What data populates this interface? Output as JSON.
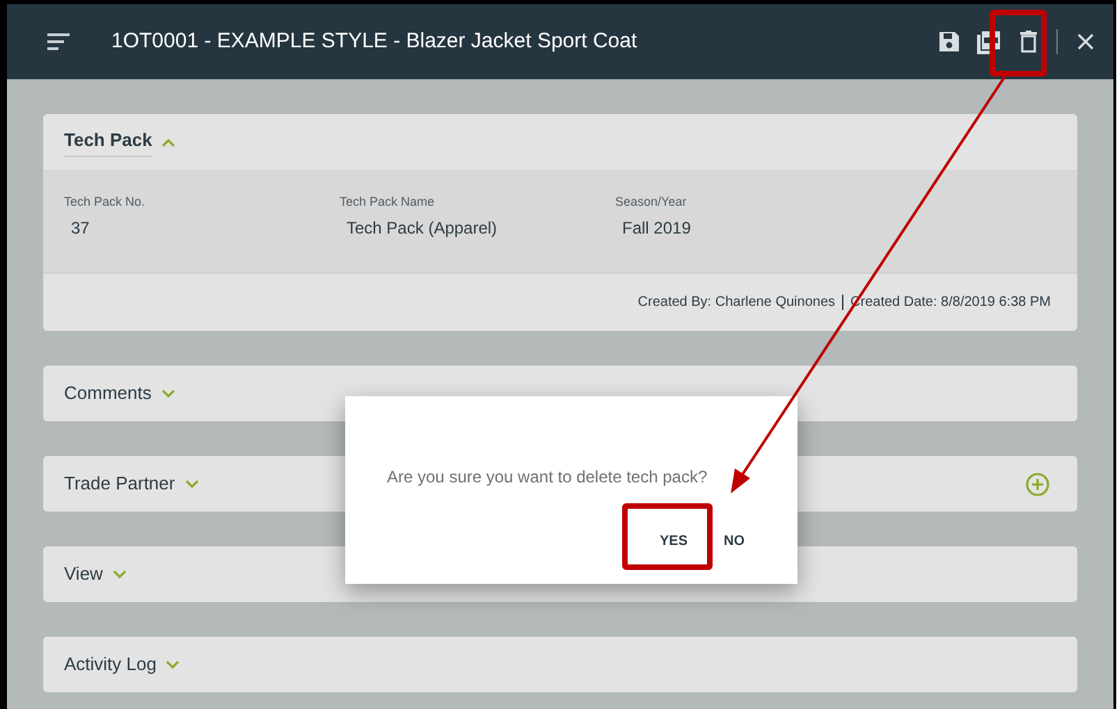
{
  "header": {
    "title": "1OT0001 - EXAMPLE STYLE - Blazer Jacket Sport Coat"
  },
  "sections": [
    {
      "title": "Tech Pack",
      "expanded": true,
      "fields": [
        {
          "label": "Tech Pack No.",
          "value": "37"
        },
        {
          "label": "Tech Pack Name",
          "value": "Tech Pack (Apparel)"
        },
        {
          "label": "Season/Year",
          "value": "Fall 2019"
        }
      ],
      "created_by": "Created By: Charlene Quinones",
      "created_date": "Created Date: 8/8/2019 6:38 PM"
    },
    {
      "title": "Comments",
      "expanded": false
    },
    {
      "title": "Trade Partner",
      "expanded": false,
      "add_button": true
    },
    {
      "title": "View",
      "expanded": false
    },
    {
      "title": "Activity Log",
      "expanded": false
    }
  ],
  "dialog": {
    "message": "Are you sure you want to delete tech pack?",
    "buttons": [
      "YES",
      "NO"
    ]
  }
}
